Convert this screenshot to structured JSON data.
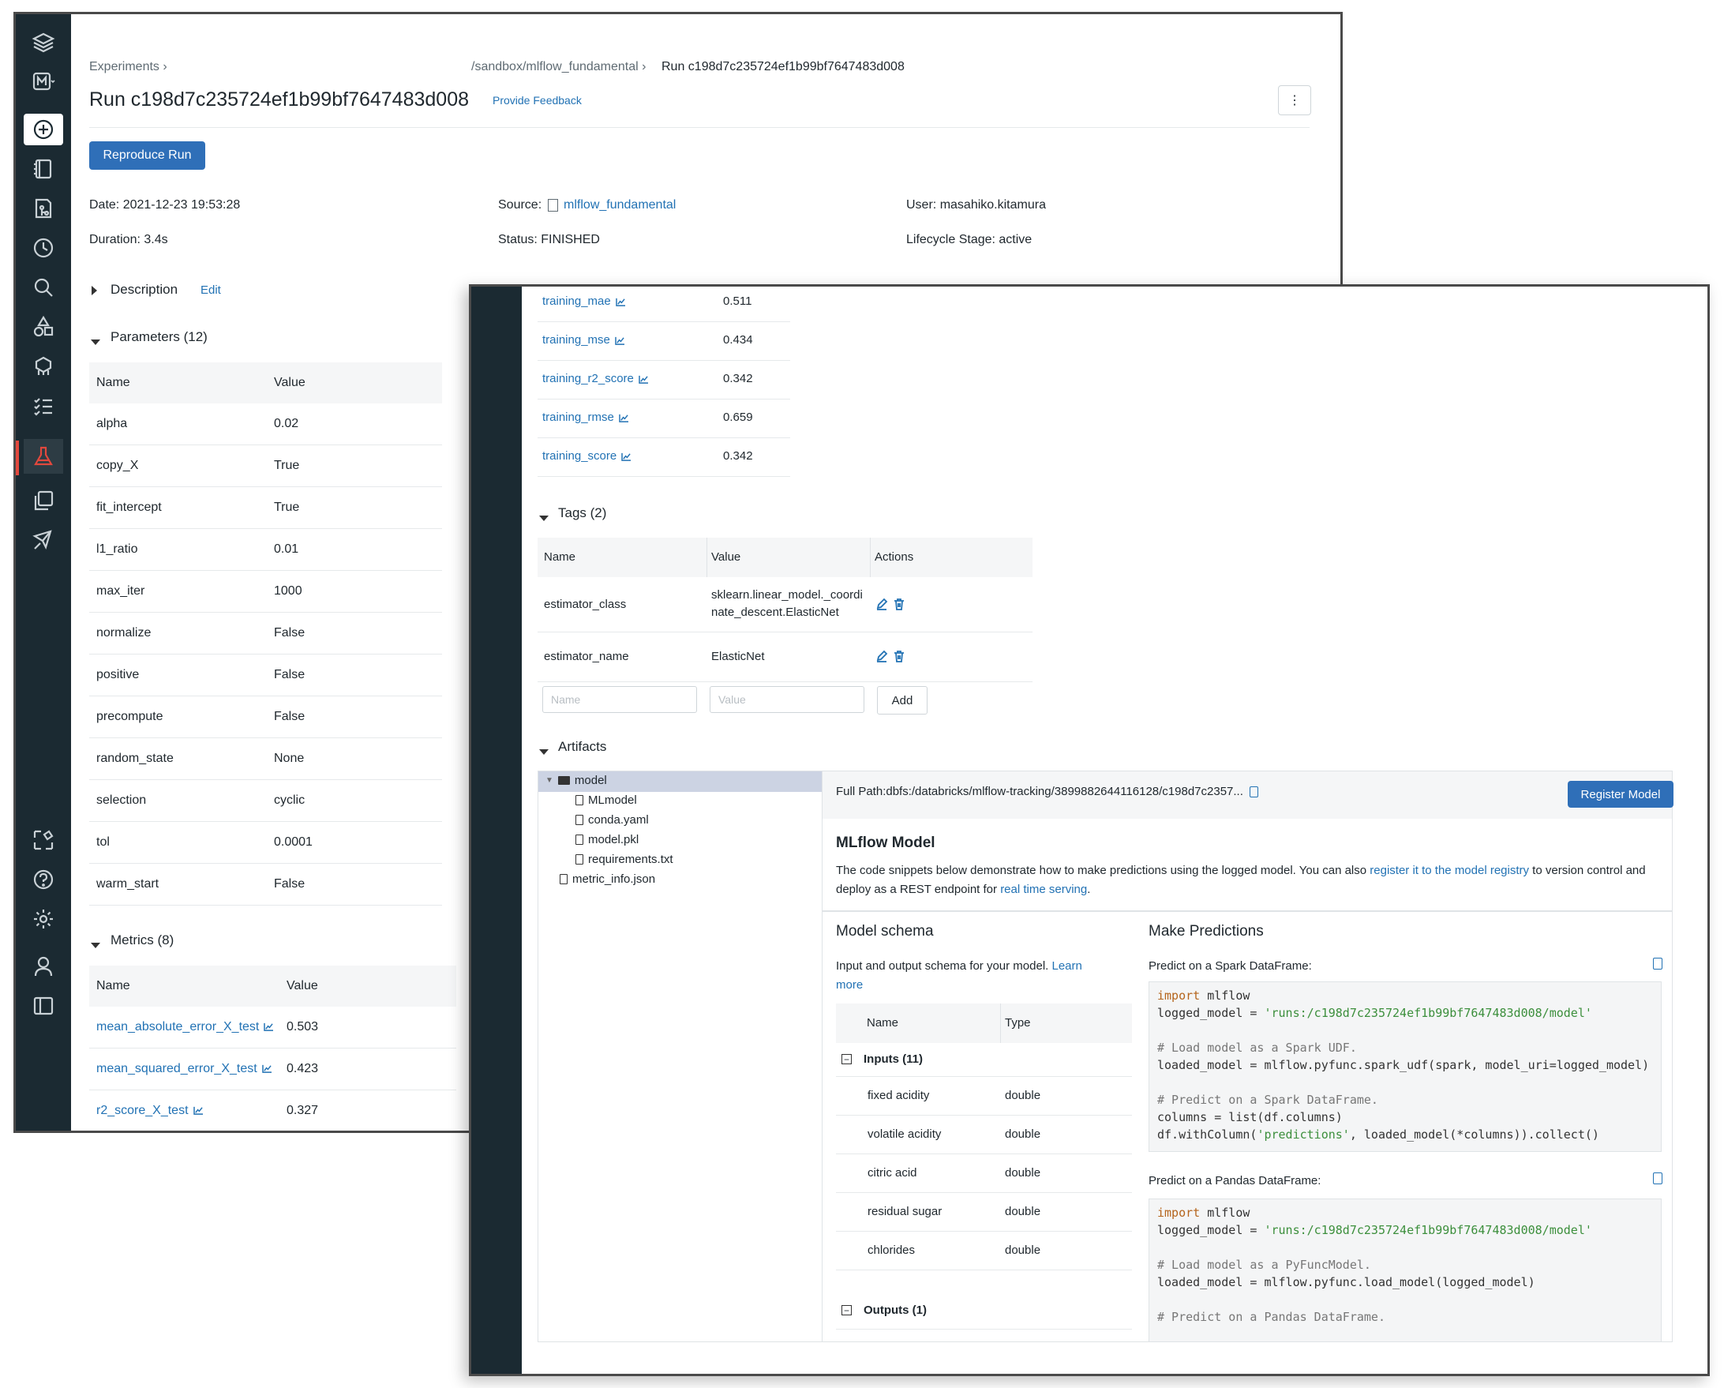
{
  "breadcrumb": {
    "experiments": "Experiments",
    "path": "/sandbox/mlflow_fundamental",
    "run": "Run c198d7c235724ef1b99bf7647483d008"
  },
  "title": "Run c198d7c235724ef1b99bf7647483d008",
  "feedback": "Provide Feedback",
  "more_button": "⋮",
  "reproduce_button": "Reproduce Run",
  "meta": {
    "date_label": "Date:",
    "date_value": "2021-12-23 19:53:28",
    "source_label": "Source:",
    "source_value": "mlflow_fundamental",
    "user_label": "User:",
    "user_value": "masahiko.kitamura",
    "duration_label": "Duration:",
    "duration_value": "3.4s",
    "status_label": "Status:",
    "status_value": "FINISHED",
    "lifecycle_label": "Lifecycle Stage:",
    "lifecycle_value": "active"
  },
  "description": {
    "label": "Description",
    "edit": "Edit"
  },
  "parameters": {
    "label": "Parameters (12)",
    "headers": [
      "Name",
      "Value"
    ],
    "rows": [
      [
        "alpha",
        "0.02"
      ],
      [
        "copy_X",
        "True"
      ],
      [
        "fit_intercept",
        "True"
      ],
      [
        "l1_ratio",
        "0.01"
      ],
      [
        "max_iter",
        "1000"
      ],
      [
        "normalize",
        "False"
      ],
      [
        "positive",
        "False"
      ],
      [
        "precompute",
        "False"
      ],
      [
        "random_state",
        "None"
      ],
      [
        "selection",
        "cyclic"
      ],
      [
        "tol",
        "0.0001"
      ],
      [
        "warm_start",
        "False"
      ]
    ]
  },
  "metrics": {
    "label": "Metrics (8)",
    "headers": [
      "Name",
      "Value"
    ],
    "rows": [
      [
        "mean_absolute_error_X_test",
        "0.503"
      ],
      [
        "mean_squared_error_X_test",
        "0.423"
      ],
      [
        "r2_score_X_test",
        "0.327"
      ]
    ],
    "more_rows": [
      [
        "training_mae",
        "0.511"
      ],
      [
        "training_mse",
        "0.434"
      ],
      [
        "training_r2_score",
        "0.342"
      ],
      [
        "training_rmse",
        "0.659"
      ],
      [
        "training_score",
        "0.342"
      ]
    ]
  },
  "tags": {
    "label": "Tags (2)",
    "headers": [
      "Name",
      "Value",
      "Actions"
    ],
    "rows": [
      {
        "name": "estimator_class",
        "value_line1": "sklearn.linear_model._coordi",
        "value_line2": "nate_descent.ElasticNet"
      },
      {
        "name": "estimator_name",
        "value_line1": "ElasticNet",
        "value_line2": ""
      }
    ],
    "name_placeholder": "Name",
    "value_placeholder": "Value",
    "add_button": "Add"
  },
  "artifacts": {
    "label": "Artifacts",
    "tree": [
      "model",
      "MLmodel",
      "conda.yaml",
      "model.pkl",
      "requirements.txt",
      "metric_info.json"
    ],
    "full_path": "Full Path:dbfs:/databricks/mlflow-tracking/3899882644116128/c198d7c2357...",
    "register_button": "Register Model",
    "model_title": "MLflow Model",
    "desc_part1": "The code snippets below demonstrate how to make predictions using the logged model. You can also ",
    "desc_link1": "register it to the model registry",
    "desc_part2": " to version control and",
    "desc_part3": "deploy as a REST endpoint for ",
    "desc_link2": "real time serving",
    "desc_part4": ".",
    "schema": {
      "title": "Model schema",
      "desc": "Input and output schema for your model.",
      "learn1": "Learn",
      "learn2": "more",
      "headers": [
        "Name",
        "Type"
      ],
      "inputs_label": "Inputs (11)",
      "inputs": [
        [
          "fixed acidity",
          "double"
        ],
        [
          "volatile acidity",
          "double"
        ],
        [
          "citric acid",
          "double"
        ],
        [
          "residual sugar",
          "double"
        ],
        [
          "chlorides",
          "double"
        ]
      ],
      "outputs_label": "Outputs (1)"
    },
    "predictions": {
      "title": "Make Predictions",
      "spark_label": "Predict on a Spark DataFrame:",
      "spark_code": [
        "import mlflow",
        "logged_model = 'runs:/c198d7c235724ef1b99bf7647483d008/model'",
        "",
        "# Load model as a Spark UDF.",
        "loaded_model = mlflow.pyfunc.spark_udf(spark, model_uri=logged_model)",
        "",
        "# Predict on a Spark DataFrame.",
        "columns = list(df.columns)",
        "df.withColumn('predictions', loaded_model(*columns)).collect()"
      ],
      "pandas_label": "Predict on a Pandas DataFrame:",
      "pandas_code": [
        "import mlflow",
        "logged_model = 'runs:/c198d7c235724ef1b99bf7647483d008/model'",
        "",
        "# Load model as a PyFuncModel.",
        "loaded_model = mlflow.pyfunc.load_model(logged_model)",
        "",
        "# Predict on a Pandas DataFrame."
      ]
    }
  }
}
